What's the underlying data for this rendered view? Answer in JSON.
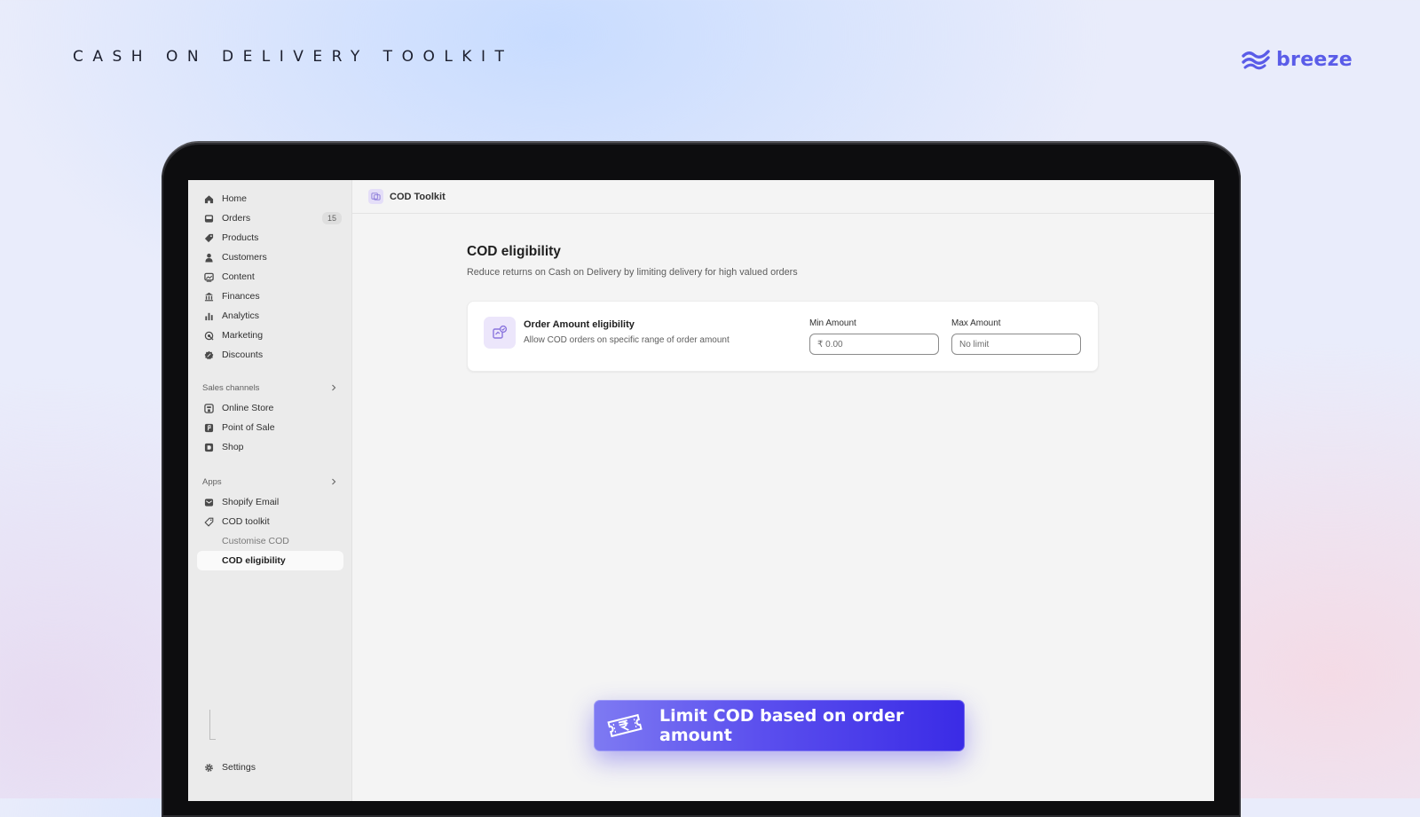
{
  "headline": "CASH ON DELIVERY TOOLKIT",
  "brand": {
    "name": "breeze",
    "color": "#5a5ce8"
  },
  "sidebar": {
    "items": [
      {
        "label": "Home",
        "icon": "home-icon"
      },
      {
        "label": "Orders",
        "icon": "inbox-icon",
        "badge": "15"
      },
      {
        "label": "Products",
        "icon": "tag-icon"
      },
      {
        "label": "Customers",
        "icon": "person-icon"
      },
      {
        "label": "Content",
        "icon": "image-icon"
      },
      {
        "label": "Finances",
        "icon": "bank-icon"
      },
      {
        "label": "Analytics",
        "icon": "bar-chart-icon"
      },
      {
        "label": "Marketing",
        "icon": "target-icon"
      },
      {
        "label": "Discounts",
        "icon": "discount-icon"
      }
    ],
    "sales_channels": {
      "title": "Sales channels",
      "items": [
        {
          "label": "Online Store",
          "icon": "store-icon"
        },
        {
          "label": "Point of Sale",
          "icon": "pos-icon"
        },
        {
          "label": "Shop",
          "icon": "shop-icon"
        }
      ]
    },
    "apps": {
      "title": "Apps",
      "items": [
        {
          "label": "Shopify Email",
          "icon": "email-icon"
        },
        {
          "label": "COD toolkit",
          "icon": "tag-outline-icon"
        }
      ],
      "sub_items": [
        {
          "label": "Customise COD"
        },
        {
          "label": "COD eligibility",
          "active": true
        }
      ]
    },
    "settings_label": "Settings"
  },
  "topbar": {
    "title": "COD Toolkit"
  },
  "page": {
    "title": "COD eligibility",
    "subtitle": "Reduce returns on Cash on Delivery by limiting delivery for high valued orders"
  },
  "card": {
    "title": "Order Amount eligibility",
    "description": "Allow COD orders on specific range of order amount",
    "min_label": "Min Amount",
    "min_value": "₹ 0.00",
    "max_label": "Max Amount",
    "max_placeholder": "No limit"
  },
  "banner": {
    "text": "Limit COD based on order amount"
  }
}
